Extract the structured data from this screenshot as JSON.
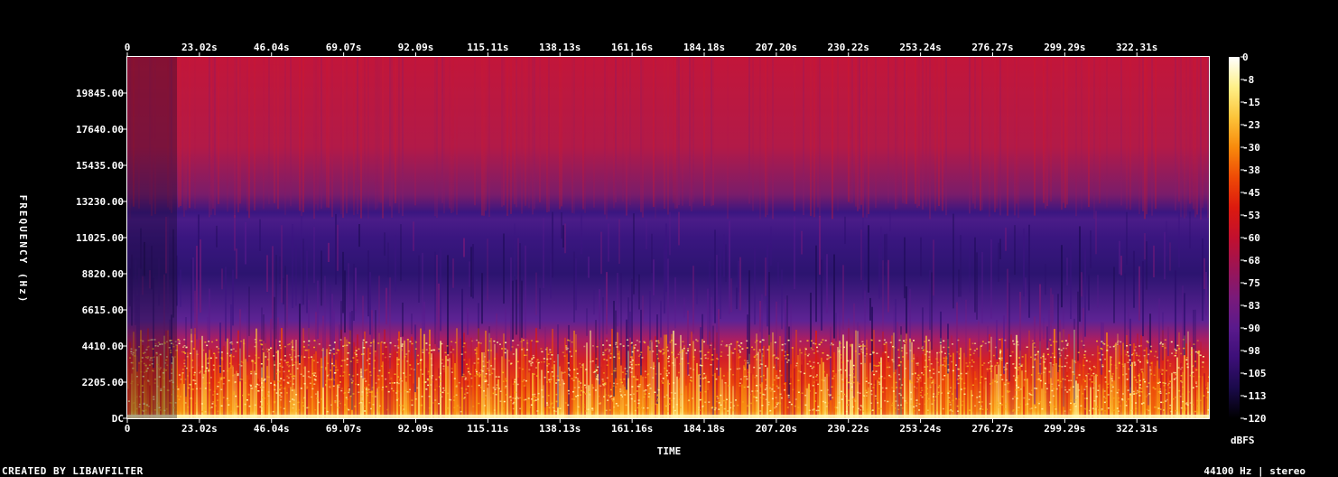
{
  "chart_data": {
    "type": "heatmap",
    "title": "",
    "xlabel": "TIME",
    "ylabel": "FREQUENCY (Hz)",
    "x_ticks": [
      "0",
      "23.02s",
      "46.04s",
      "69.07s",
      "92.09s",
      "115.11s",
      "138.13s",
      "161.16s",
      "184.18s",
      "207.20s",
      "230.22s",
      "253.24s",
      "276.27s",
      "299.29s",
      "322.31s"
    ],
    "x_tick_values": [
      0,
      23.02,
      46.04,
      69.07,
      92.09,
      115.11,
      138.13,
      161.16,
      184.18,
      207.2,
      230.22,
      253.24,
      276.27,
      299.29,
      322.31
    ],
    "xlim": [
      0,
      345.3
    ],
    "y_ticks": [
      "DC",
      "2205.00",
      "4410.00",
      "6615.00",
      "8820.00",
      "11025.00",
      "13230.00",
      "15435.00",
      "17640.00",
      "19845.00"
    ],
    "y_tick_values": [
      0,
      2205,
      4410,
      6615,
      8820,
      11025,
      13230,
      15435,
      17640,
      19845
    ],
    "ylim": [
      0,
      22050
    ],
    "colorbar": {
      "label": "dBFS",
      "ticks": [
        "0",
        "-8",
        "-15",
        "-23",
        "-30",
        "-38",
        "-45",
        "-53",
        "-60",
        "-68",
        "-75",
        "-83",
        "-90",
        "-98",
        "-105",
        "-113",
        "-120"
      ],
      "range": [
        -120,
        0
      ],
      "colormap": [
        "#000000",
        "#1a0a4a",
        "#3c0f78",
        "#5a1a8c",
        "#7a1a7a",
        "#9c1454",
        "#c2102e",
        "#dc1a0e",
        "#ee4a06",
        "#f88a0c",
        "#fcc43a",
        "#fef088",
        "#ffffff"
      ]
    },
    "bands": [
      {
        "from_hz": 0,
        "to_hz": 500,
        "level_dbfs": -15
      },
      {
        "from_hz": 500,
        "to_hz": 3500,
        "level_dbfs": -40
      },
      {
        "from_hz": 3500,
        "to_hz": 5000,
        "level_dbfs": -60
      },
      {
        "from_hz": 5000,
        "to_hz": 12000,
        "level_dbfs": -95
      },
      {
        "from_hz": 12000,
        "to_hz": 13200,
        "level_dbfs": -85
      },
      {
        "from_hz": 13200,
        "to_hz": 22050,
        "level_dbfs": -63
      }
    ],
    "grid": false
  },
  "footer": {
    "credit": "CREATED BY LIBAVFILTER",
    "format": "44100 Hz | stereo"
  }
}
